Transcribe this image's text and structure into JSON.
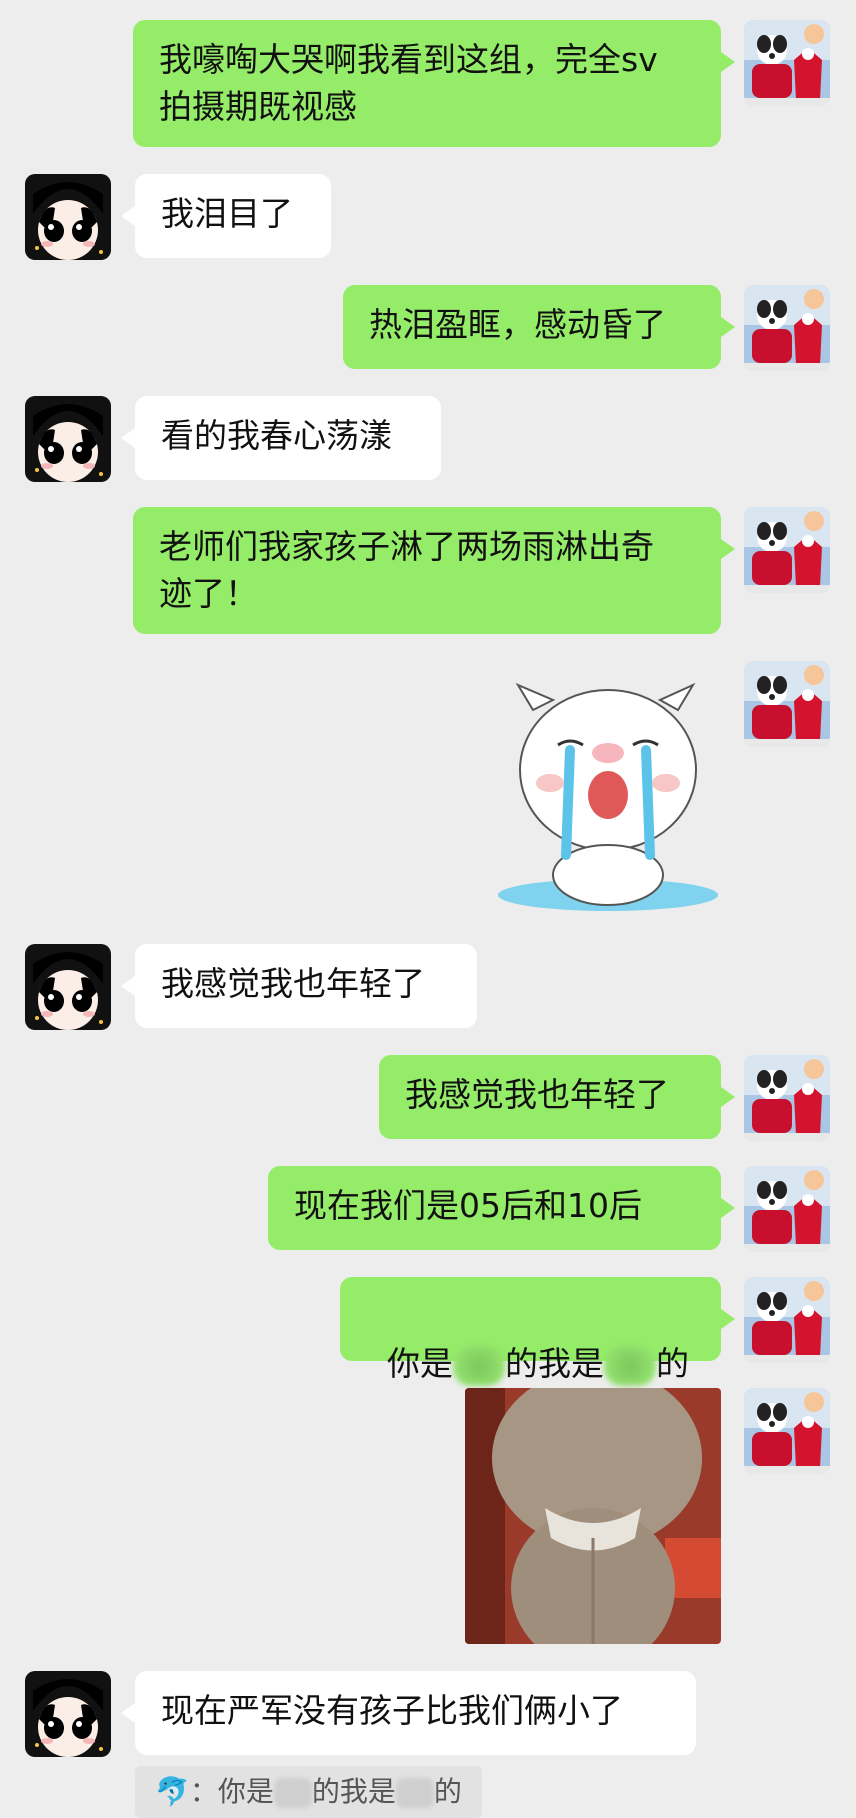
{
  "messages": [
    {
      "text": "我嚎啕大哭啊我看到这组，完全sv\n拍摄期既视感"
    },
    {
      "text": "我泪目了"
    },
    {
      "text": "热泪盈眶，感动昏了"
    },
    {
      "text": "看的我春心荡漾"
    },
    {
      "text": "老师们我家孩子淋了两场雨淋出奇\n迹了！"
    },
    {
      "sticker": "crying-pig-sticker"
    },
    {
      "text": "我感觉我也年轻了"
    },
    {
      "text": "我感觉我也年轻了"
    },
    {
      "text": "现在我们是05后和10后"
    },
    {
      "part1": "你是",
      "part2": "的我是",
      "part3": "的"
    },
    {
      "image": "plush-toy-photo"
    },
    {
      "text": "现在严军没有孩子比我们俩小了"
    }
  ],
  "quote": {
    "prefix": "：",
    "part1": "你是",
    "part2": "的我是",
    "part3": "的"
  },
  "colors": {
    "background": "#ededed",
    "outgoing_bubble": "#95ec69",
    "incoming_bubble": "#ffffff"
  }
}
